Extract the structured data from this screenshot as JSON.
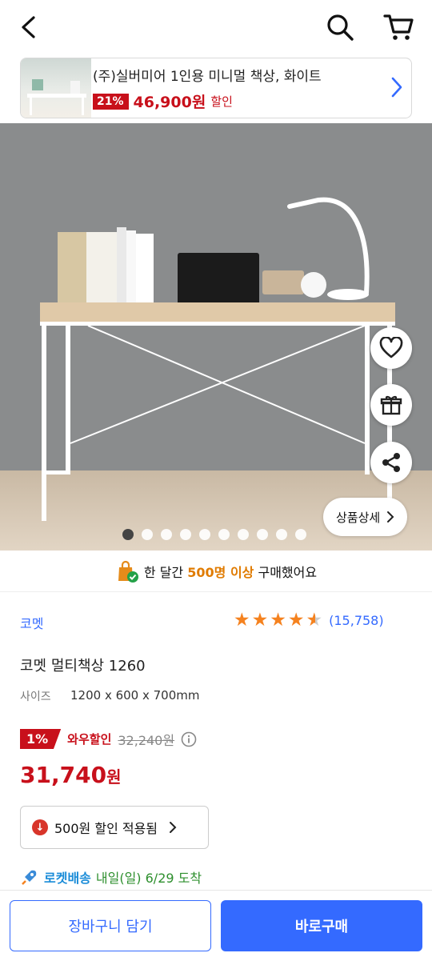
{
  "header": {
    "back_icon": "back-arrow",
    "search_icon": "search",
    "cart_icon": "cart"
  },
  "promo": {
    "title": "(주)실버미어 1인용 미니멀 책상, 화이트",
    "discount": "21%",
    "price": "46,900원",
    "sale_label": "할인"
  },
  "hero": {
    "detail_button": "상품상세",
    "dots_total": 10,
    "dots_active": 0
  },
  "social_proof": {
    "prefix": "한 달간 ",
    "highlight": "500명 이상",
    "suffix": " 구매했어요"
  },
  "product": {
    "brand": "코멧",
    "rating_stars": 4.5,
    "review_count": "(15,758)",
    "title": "코멧 멀티책상 1260",
    "size_label": "사이즈",
    "size_value": "1200 x 600 x 700mm"
  },
  "pricing": {
    "discount_pct": "1%",
    "wow_label": "와우할인",
    "original_price": "32,240원",
    "final_price": "31,740",
    "final_unit": "원"
  },
  "coupon": {
    "label": "500원 할인 적용됨"
  },
  "delivery": {
    "name": "로켓배송",
    "date": "내일(일) 6/29 도착"
  },
  "actions": {
    "cart_button": "장바구니 담기",
    "buy_button": "바로구매"
  },
  "colors": {
    "accent": "#346aff",
    "sale": "#c8101b",
    "star": "#f5821f"
  }
}
